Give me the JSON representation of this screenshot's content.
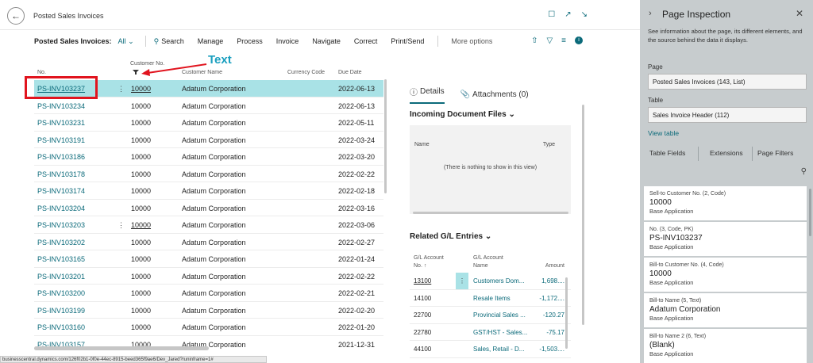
{
  "app": {
    "page_title": "Posted Sales Invoices"
  },
  "actionbar": {
    "caption": "Posted Sales Invoices:",
    "filter": "All",
    "items": [
      "Search",
      "Manage",
      "Process",
      "Invoice",
      "Navigate",
      "Correct",
      "Print/Send"
    ],
    "more": "More options"
  },
  "list": {
    "headers": {
      "no": "No.",
      "customer_no_top": "Customer No.",
      "customer_name": "Customer Name",
      "currency_code": "Currency Code",
      "due_date": "Due Date"
    },
    "rows": [
      {
        "no": "PS-INV103237",
        "customer": "10000",
        "name": "Adatum Corporation",
        "due": "2022-06-13"
      },
      {
        "no": "PS-INV103234",
        "customer": "10000",
        "name": "Adatum Corporation",
        "due": "2022-06-13"
      },
      {
        "no": "PS-INV103231",
        "customer": "10000",
        "name": "Adatum Corporation",
        "due": "2022-05-11"
      },
      {
        "no": "PS-INV103191",
        "customer": "10000",
        "name": "Adatum Corporation",
        "due": "2022-03-24"
      },
      {
        "no": "PS-INV103186",
        "customer": "10000",
        "name": "Adatum Corporation",
        "due": "2022-03-20"
      },
      {
        "no": "PS-INV103178",
        "customer": "10000",
        "name": "Adatum Corporation",
        "due": "2022-02-22"
      },
      {
        "no": "PS-INV103174",
        "customer": "10000",
        "name": "Adatum Corporation",
        "due": "2022-02-18"
      },
      {
        "no": "PS-INV103204",
        "customer": "10000",
        "name": "Adatum Corporation",
        "due": "2022-03-16"
      },
      {
        "no": "PS-INV103203",
        "customer": "10000",
        "name": "Adatum Corporation",
        "due": "2022-03-06"
      },
      {
        "no": "PS-INV103202",
        "customer": "10000",
        "name": "Adatum Corporation",
        "due": "2022-02-27"
      },
      {
        "no": "PS-INV103165",
        "customer": "10000",
        "name": "Adatum Corporation",
        "due": "2022-01-24"
      },
      {
        "no": "PS-INV103201",
        "customer": "10000",
        "name": "Adatum Corporation",
        "due": "2022-02-22"
      },
      {
        "no": "PS-INV103200",
        "customer": "10000",
        "name": "Adatum Corporation",
        "due": "2022-02-21"
      },
      {
        "no": "PS-INV103199",
        "customer": "10000",
        "name": "Adatum Corporation",
        "due": "2022-02-20"
      },
      {
        "no": "PS-INV103160",
        "customer": "10000",
        "name": "Adatum Corporation",
        "due": "2022-01-20"
      },
      {
        "no": "PS-INV103157",
        "customer": "10000",
        "name": "Adatum Corporation",
        "due": "2021-12-31"
      }
    ]
  },
  "annotation": {
    "text": "Text"
  },
  "factbox": {
    "tab_details": "Details",
    "tab_attachments": "Attachments (0)",
    "incoming_title": "Incoming Document Files",
    "incoming_col_name": "Name",
    "incoming_col_type": "Type",
    "incoming_empty": "(There is nothing to show in this view)",
    "gl_title": "Related G/L Entries",
    "gl_col_no_1": "G/L Account",
    "gl_col_no_2": "No. ↑",
    "gl_col_name_1": "G/L Account",
    "gl_col_name_2": "Name",
    "gl_col_amount": "Amount",
    "gl_rows": [
      {
        "no": "13100",
        "name": "Customers Dom...",
        "amount": "1,698...."
      },
      {
        "no": "14100",
        "name": "Resale Items",
        "amount": "-1,172...."
      },
      {
        "no": "22700",
        "name": "Provincial Sales ...",
        "amount": "-120.27"
      },
      {
        "no": "22780",
        "name": "GST/HST - Sales...",
        "amount": "-75.17"
      },
      {
        "no": "44100",
        "name": "Sales, Retail - D...",
        "amount": "-1,503...."
      }
    ]
  },
  "statusbar": {
    "url": "businesscentral.dynamics.com/126f02b1-0f0e-44ec-8915-beed365f9ae6/Dev_Jared?runinframe=1#"
  },
  "inspection": {
    "title": "Page Inspection",
    "description": "See information about the page, its different elements, and the source behind the data it displays.",
    "page_label": "Page",
    "page_value": "Posted Sales Invoices (143, List)",
    "table_label": "Table",
    "table_value": "Sales Invoice Header (112)",
    "view_table": "View table",
    "tabs": [
      "Table Fields",
      "Extensions",
      "Page Filters"
    ],
    "cards": [
      {
        "label": "Sell-to Customer No. (2, Code)",
        "value": "10000",
        "source": "Base Application"
      },
      {
        "label": "No. (3, Code, PK)",
        "value": "PS-INV103237",
        "source": "Base Application"
      },
      {
        "label": "Bill-to Customer No. (4, Code)",
        "value": "10000",
        "source": "Base Application"
      },
      {
        "label": "Bill-to Name (5, Text)",
        "value": "Adatum Corporation",
        "source": "Base Application"
      },
      {
        "label": "Bill-to Name 2 (6, Text)",
        "value": "(Blank)",
        "source": "Base Application"
      }
    ]
  },
  "colors": {
    "accent": "#0b6a7a",
    "selected_row": "#a9e2e6",
    "annotation_red": "#e1141e",
    "annotation_text": "#1a9fbf",
    "panel_bg": "#c7ccce"
  }
}
